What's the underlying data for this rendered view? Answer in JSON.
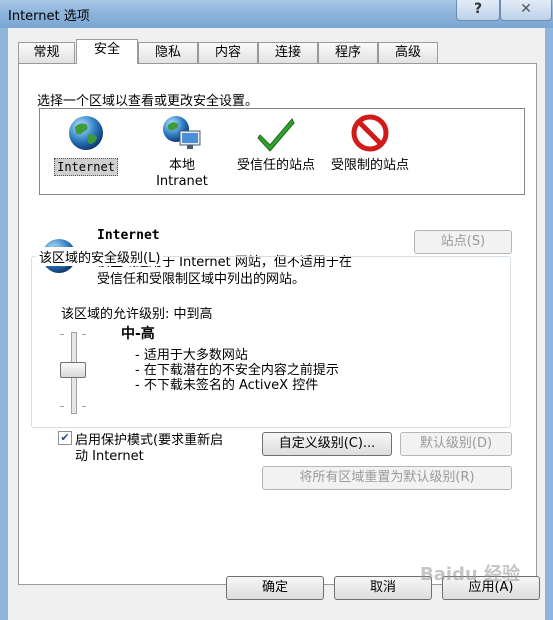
{
  "window": {
    "title": "Internet 选项",
    "help_label": "?",
    "close_label": "✕"
  },
  "tabs": [
    {
      "label": "常规",
      "active": false
    },
    {
      "label": "安全",
      "active": true
    },
    {
      "label": "隐私",
      "active": false
    },
    {
      "label": "内容",
      "active": false
    },
    {
      "label": "连接",
      "active": false
    },
    {
      "label": "程序",
      "active": false
    },
    {
      "label": "高级",
      "active": false
    }
  ],
  "security": {
    "zone_prompt": "选择一个区域以查看或更改安全设置。",
    "zones": [
      {
        "label": "Internet",
        "icon": "globe-icon",
        "selected": true
      },
      {
        "label_line1": "本地",
        "label_line2": "Intranet",
        "icon": "local-intranet-icon"
      },
      {
        "label": "受信任的站点",
        "icon": "trusted-check-icon"
      },
      {
        "label": "受限制的站点",
        "icon": "restricted-icon"
      }
    ],
    "zone_info": {
      "title": "Internet",
      "desc_line1": "该区域适用于 Internet 网站，但不适用于在",
      "desc_line2": "受信任和受限制区域中列出的网站。",
      "sites_button": "站点(S)"
    },
    "level_group": {
      "title": "该区域的安全级别(L)",
      "allowed": "该区域的允许级别: 中到高",
      "level_name": "中-高",
      "bullets": [
        "- 适用于大多数网站",
        "- 在下载潜在的不安全内容之前提示",
        "- 不下载未签名的 ActiveX 控件"
      ],
      "protected_mode_line1": "启用保护模式(要求重新启",
      "protected_mode_line2": "动 Internet",
      "protected_mode_checked": true,
      "custom_button": "自定义级别(C)...",
      "default_button": "默认级别(D)",
      "reset_all_button": "将所有区域重置为默认级别(R)"
    }
  },
  "footer": {
    "ok": "确定",
    "cancel": "取消",
    "apply": "应用(A)"
  },
  "watermark": "Baidu 经验"
}
